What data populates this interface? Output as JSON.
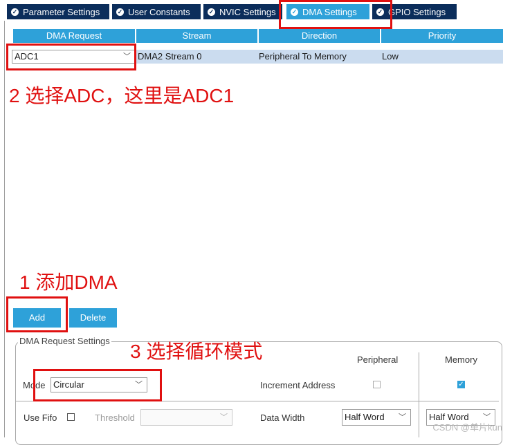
{
  "tabs": [
    {
      "label": "Parameter Settings"
    },
    {
      "label": "User Constants"
    },
    {
      "label": "NVIC Settings"
    },
    {
      "label": "DMA Settings"
    },
    {
      "label": "GPIO Settings"
    }
  ],
  "table": {
    "headers": [
      "DMA Request",
      "Stream",
      "Direction",
      "Priority"
    ],
    "rows": [
      {
        "request": "ADC1",
        "stream": "DMA2 Stream 0",
        "direction": "Peripheral To Memory",
        "priority": "Low"
      }
    ]
  },
  "annotations": {
    "step2": "2 选择ADC，这里是ADC1",
    "step1": "1 添加DMA",
    "step3": "3 选择循环模式"
  },
  "buttons": {
    "add": "Add",
    "delete": "Delete"
  },
  "settings": {
    "title": "DMA Request Settings",
    "col_peripheral": "Peripheral",
    "col_memory": "Memory",
    "mode_label": "Mode",
    "mode_value": "Circular",
    "increment_label": "Increment Address",
    "use_fifo_label": "Use Fifo",
    "threshold_label": "Threshold",
    "data_width_label": "Data Width",
    "peripheral_width": "Half Word",
    "memory_width": "Half Word"
  },
  "state": {
    "active_tab": "DMA Settings",
    "peripheral_increment": false,
    "memory_increment": true,
    "use_fifo": false
  },
  "watermark": "CSDN @单片kun",
  "colors": {
    "tab_bg": "#0b2d5b",
    "accent": "#2ea1d9",
    "annotation": "#e01010",
    "row_selected": "#cbdcef"
  }
}
